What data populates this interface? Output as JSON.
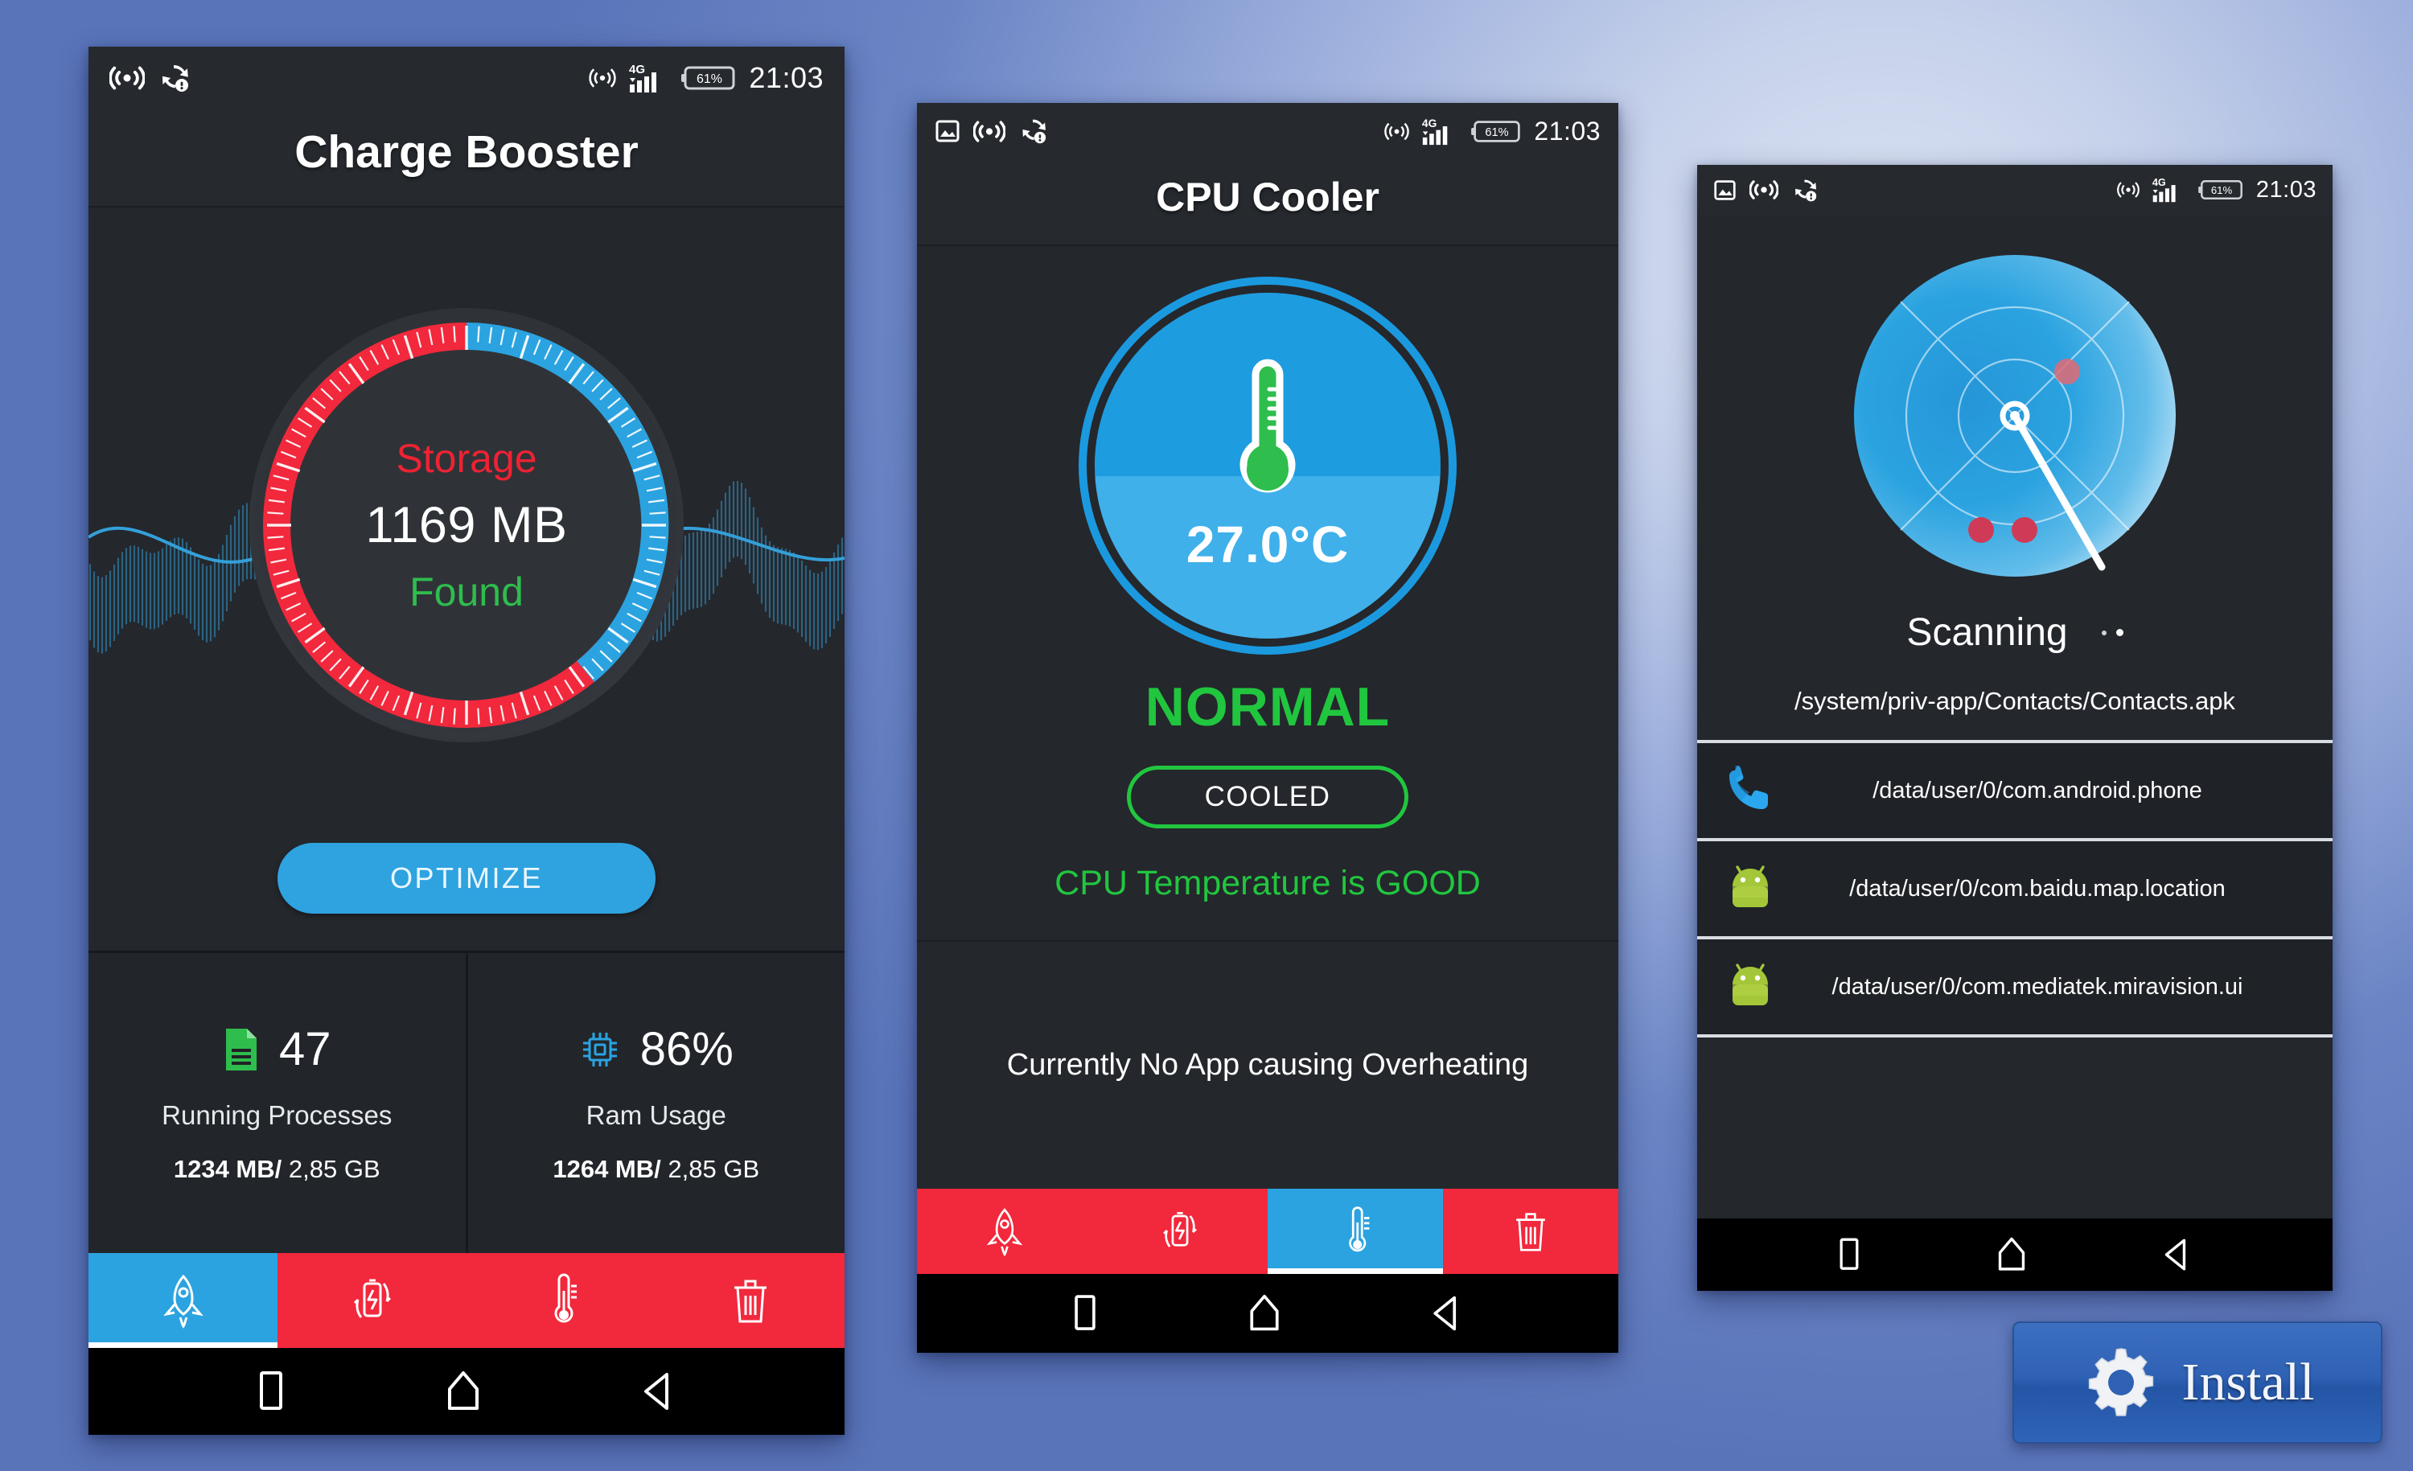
{
  "statusbar": {
    "time": "21:03",
    "battery": "61%",
    "network": "4G",
    "icons_left_phone1": [
      "wifi-cast-icon",
      "sync-error-icon"
    ],
    "icons_left_phone2": [
      "screenshot-icon",
      "wifi-cast-icon",
      "sync-error-icon"
    ],
    "icons_left_phone3": [
      "screenshot-icon",
      "wifi-cast-icon",
      "sync-error-icon"
    ],
    "icons_right": [
      "hotspot-icon",
      "signal-4g-icon",
      "battery-icon"
    ]
  },
  "phone1": {
    "title": "Charge Booster",
    "gauge": {
      "top_label": "Storage",
      "value": "1169 MB",
      "bottom_label": "Found",
      "top_color": "#ef2233",
      "bottom_color": "#2fbd4d",
      "arc_used_color": "#f2283c",
      "arc_free_color": "#2ba3e0"
    },
    "optimize_label": "OPTIMIZE",
    "stats": [
      {
        "icon": "document-icon",
        "icon_color": "#2fbd4d",
        "value": "47",
        "label": "Running Processes",
        "sub_bold": "1234 MB/",
        "sub_rest": " 2,85 GB"
      },
      {
        "icon": "cpu-chip-icon",
        "icon_color": "#2ba3e0",
        "value": "86%",
        "label": "Ram Usage",
        "sub_bold": "1264 MB/",
        "sub_rest": " 2,85 GB"
      }
    ],
    "tabs": [
      {
        "name": "rocket-boost-tab",
        "icon": "rocket-icon",
        "active": true
      },
      {
        "name": "battery-saver-tab",
        "icon": "battery-recycle-icon",
        "active": false
      },
      {
        "name": "cpu-cooler-tab",
        "icon": "thermometer-icon",
        "active": false
      },
      {
        "name": "junk-cleaner-tab",
        "icon": "trash-icon",
        "active": false
      }
    ]
  },
  "phone2": {
    "title": "CPU Cooler",
    "temperature": "27.0°C",
    "status": "NORMAL",
    "status_color": "#21c63f",
    "chip_label": "COOLED",
    "good_text": "CPU Temperature is GOOD",
    "footer_text": "Currently No App causing Overheating",
    "tabs": [
      {
        "name": "rocket-boost-tab",
        "icon": "rocket-icon",
        "active": false
      },
      {
        "name": "battery-saver-tab",
        "icon": "battery-recycle-icon",
        "active": false
      },
      {
        "name": "cpu-cooler-tab",
        "icon": "thermometer-icon",
        "active": true
      },
      {
        "name": "junk-cleaner-tab",
        "icon": "trash-icon",
        "active": false
      }
    ]
  },
  "phone3": {
    "scanning_label": "Scanning",
    "current_path": "/system/priv-app/Contacts/Contacts.apk",
    "files": [
      {
        "icon": "phone-dialer-icon",
        "path": "/data/user/0/com.android.phone"
      },
      {
        "icon": "android-robot-icon",
        "path": "/data/user/0/com.baidu.map.location"
      },
      {
        "icon": "android-robot-icon",
        "path": "/data/user/0/com.mediatek.miravision.ui"
      }
    ],
    "radar": {
      "blips": 3,
      "sweep_color": "#ffffff",
      "disc_color": "#2ba3e0"
    }
  },
  "install": {
    "label": "Install",
    "icon": "gear-icon",
    "color": "#2f62b5"
  },
  "navbar": {
    "buttons": [
      {
        "name": "recents-button",
        "icon": "square-icon"
      },
      {
        "name": "home-button",
        "icon": "home-icon"
      },
      {
        "name": "back-button",
        "icon": "back-triangle-icon"
      }
    ]
  }
}
